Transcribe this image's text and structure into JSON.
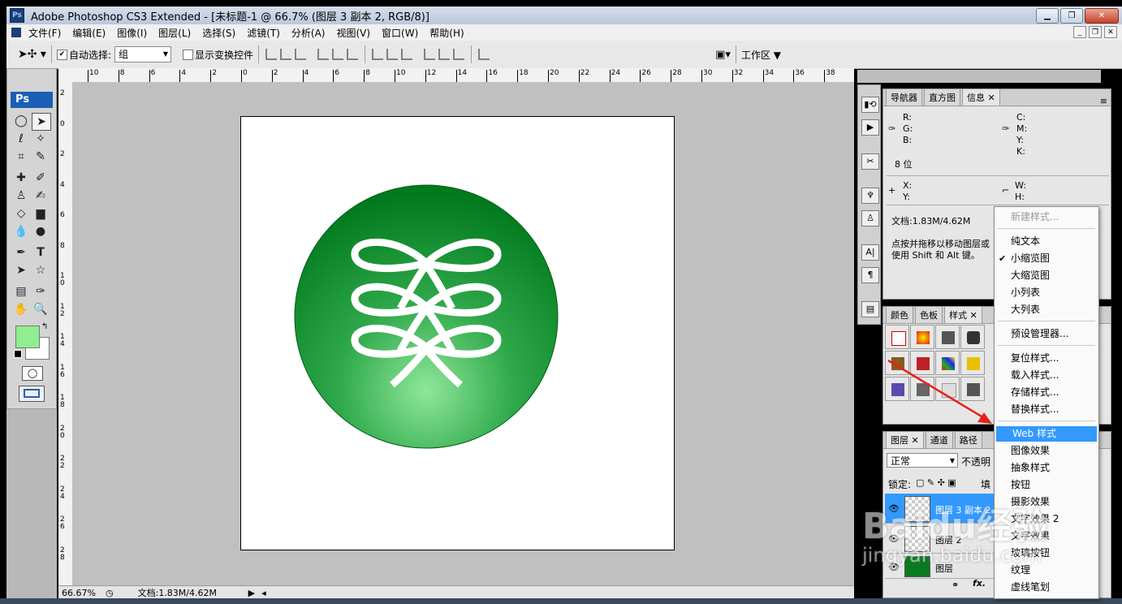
{
  "window": {
    "title": "Adobe Photoshop CS3 Extended - [未标题-1 @ 66.7% (图层 3 副本 2, RGB/8)]",
    "app_badge": "Ps"
  },
  "menubar": {
    "items": [
      "文件(F)",
      "编辑(E)",
      "图像(I)",
      "图层(L)",
      "选择(S)",
      "滤镜(T)",
      "分析(A)",
      "视图(V)",
      "窗口(W)",
      "帮助(H)"
    ]
  },
  "options": {
    "auto_select_label": "自动选择:",
    "auto_select_value": "组",
    "show_transform_label": "显示变换控件",
    "workspace_label": "工作区"
  },
  "ruler": {
    "h_ticks": [
      "10",
      "8",
      "6",
      "4",
      "2",
      "0",
      "2",
      "4",
      "6",
      "8",
      "10",
      "12",
      "14",
      "16",
      "18",
      "20",
      "22",
      "24",
      "26",
      "28",
      "30",
      "32",
      "34",
      "36",
      "38"
    ],
    "v_ticks": [
      "2",
      "0",
      "2",
      "4",
      "6",
      "8",
      "1 0",
      "1 2",
      "1 4",
      "1 6",
      "1 8",
      "2 0",
      "2 2",
      "2 4",
      "2 6",
      "2 8"
    ]
  },
  "status": {
    "zoom": "66.67%",
    "doc_info": "文档:1.83M/4.62M"
  },
  "info_panel": {
    "tabs": [
      "导航器",
      "直方图",
      "信息"
    ],
    "r": "R:",
    "g": "G:",
    "b": "B:",
    "c": "C:",
    "m": "M:",
    "y": "Y:",
    "k": "K:",
    "bits": "8 位",
    "x": "X:",
    "yc": "Y:",
    "w": "W:",
    "h": "H:",
    "doc": "文档:1.83M/4.62M",
    "hint1": "点按并拖移以移动图层或",
    "hint2": "使用 Shift 和 Alt 键。"
  },
  "styles_panel": {
    "tabs": [
      "颜色",
      "色板",
      "样式"
    ]
  },
  "layers_panel": {
    "tabs": [
      "图层",
      "通道",
      "路径"
    ],
    "blend_mode": "正常",
    "opacity_label": "不透明",
    "lock_label": "锁定:",
    "fill_label": "填",
    "layers": [
      "图层 3 副本 2",
      "图层 2",
      "图层"
    ]
  },
  "flyout_menu": {
    "items": [
      {
        "label": "新建样式...",
        "disabled": true
      },
      {
        "label": "纯文本"
      },
      {
        "label": "小缩览图",
        "checked": true
      },
      {
        "label": "大缩览图"
      },
      {
        "label": "小列表"
      },
      {
        "label": "大列表"
      },
      {
        "label": "预设管理器..."
      },
      {
        "label": "复位样式..."
      },
      {
        "label": "载入样式..."
      },
      {
        "label": "存储样式..."
      },
      {
        "label": "替换样式..."
      },
      {
        "label": "Web 样式",
        "highlighted": true
      },
      {
        "label": "图像效果"
      },
      {
        "label": "抽象样式"
      },
      {
        "label": "按钮"
      },
      {
        "label": "摄影效果"
      },
      {
        "label": "文字效果 2"
      },
      {
        "label": "文字效果"
      },
      {
        "label": "玻璃按钮"
      },
      {
        "label": "纹理"
      },
      {
        "label": "虚线笔划"
      }
    ],
    "check_mark": "✔"
  },
  "watermark": {
    "text": "Baidu经验",
    "subtext": "jingyan.baidu.com"
  },
  "colors": {
    "foreground": "#90ee90",
    "background": "#ffffff",
    "circle_dark": "#007a1c",
    "circle_light": "#8fe79a",
    "menu_highlight": "#3399ff",
    "arrow": "#e8201a"
  }
}
